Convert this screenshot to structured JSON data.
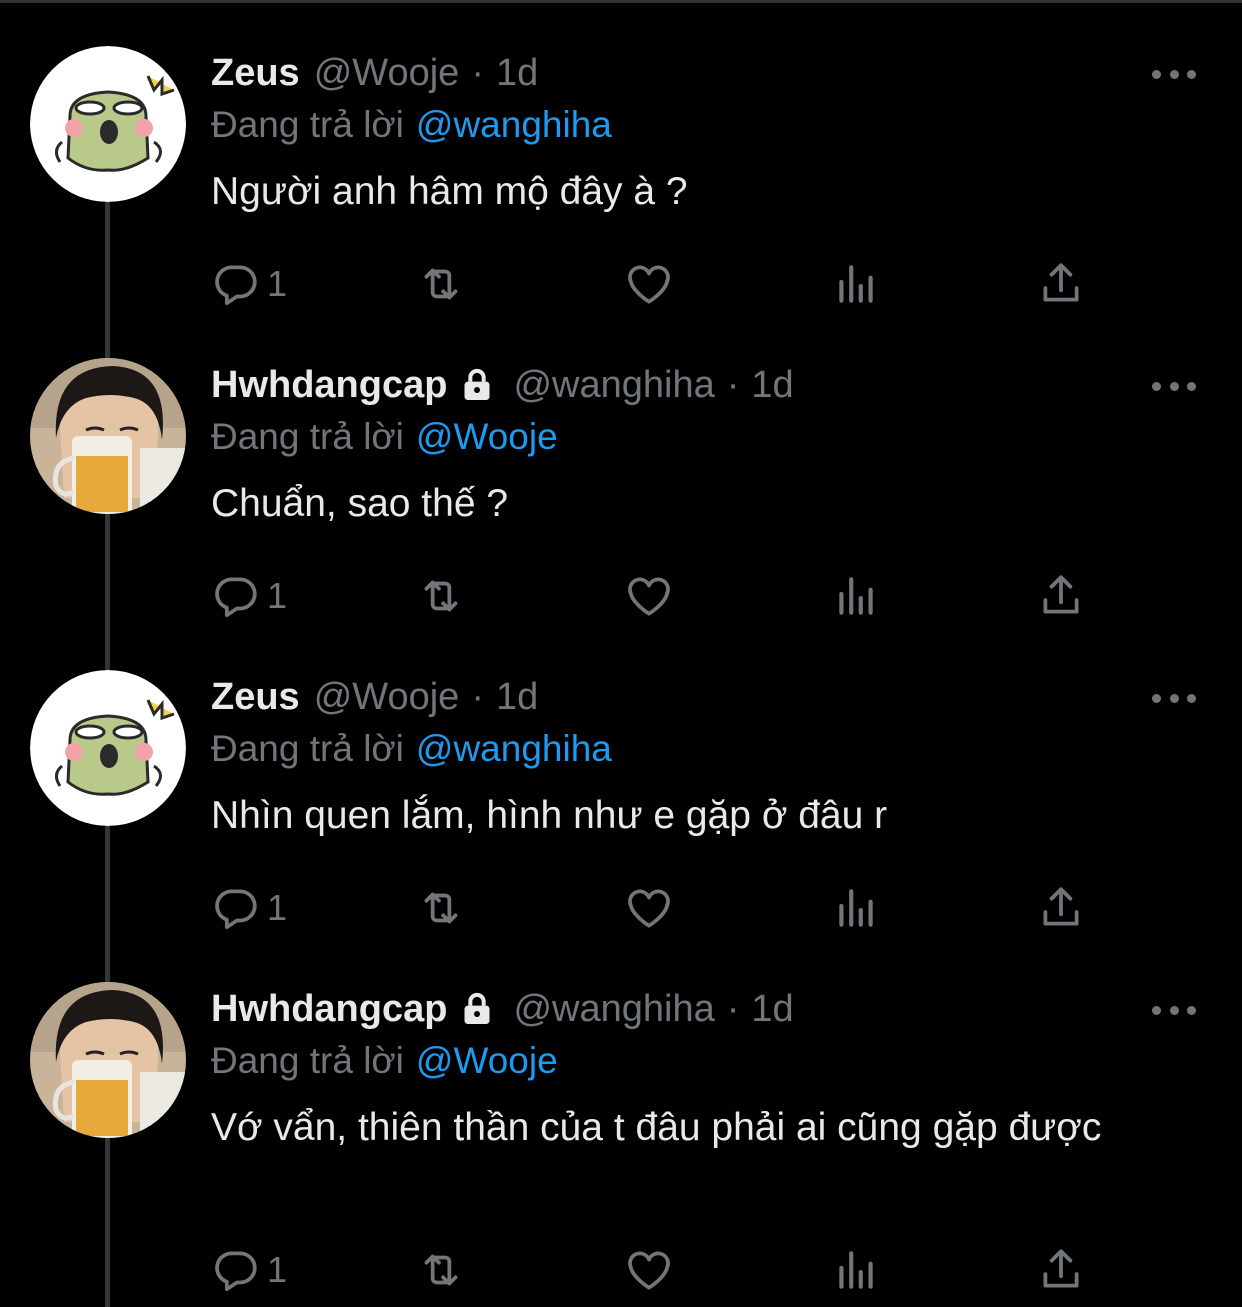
{
  "colors": {
    "background": "#000000",
    "text": "#e7e9ea",
    "muted": "#71767b",
    "link": "#1d9bf0",
    "thread_line": "#333639"
  },
  "tweets": [
    {
      "name": "Zeus",
      "handle": "@Wooje",
      "dot": "·",
      "time": "1d",
      "locked": false,
      "avatar_icon": "green-cartoon-frog-avatar",
      "reply_label": "Đang trả lời",
      "reply_to": "@wanghiha",
      "text": "Người anh hâm mộ đây à ?",
      "reply_count": "1"
    },
    {
      "name": "Hwhdangcap",
      "handle": "@wanghiha",
      "dot": "·",
      "time": "1d",
      "locked": true,
      "avatar_icon": "person-drinking-beer-avatar",
      "reply_label": "Đang trả lời",
      "reply_to": "@Wooje",
      "text": "Chuẩn, sao thế ?",
      "reply_count": "1"
    },
    {
      "name": "Zeus",
      "handle": "@Wooje",
      "dot": "·",
      "time": "1d",
      "locked": false,
      "avatar_icon": "green-cartoon-frog-avatar",
      "reply_label": "Đang trả lời",
      "reply_to": "@wanghiha",
      "text": "Nhìn quen lắm, hình như e gặp ở đâu r",
      "reply_count": "1"
    },
    {
      "name": "Hwhdangcap",
      "handle": "@wanghiha",
      "dot": "·",
      "time": "1d",
      "locked": true,
      "avatar_icon": "person-drinking-beer-avatar",
      "reply_label": "Đang trả lời",
      "reply_to": "@Wooje",
      "text": "Vớ vẩn, thiên thần của t đâu phải ai cũng gặp được",
      "reply_count": "1"
    }
  ],
  "icons": {
    "reply": "reply-bubble-icon",
    "retweet": "retweet-icon",
    "like": "heart-icon",
    "views": "analytics-icon",
    "share": "share-icon",
    "more": "more-options-icon",
    "lock": "lock-icon"
  }
}
